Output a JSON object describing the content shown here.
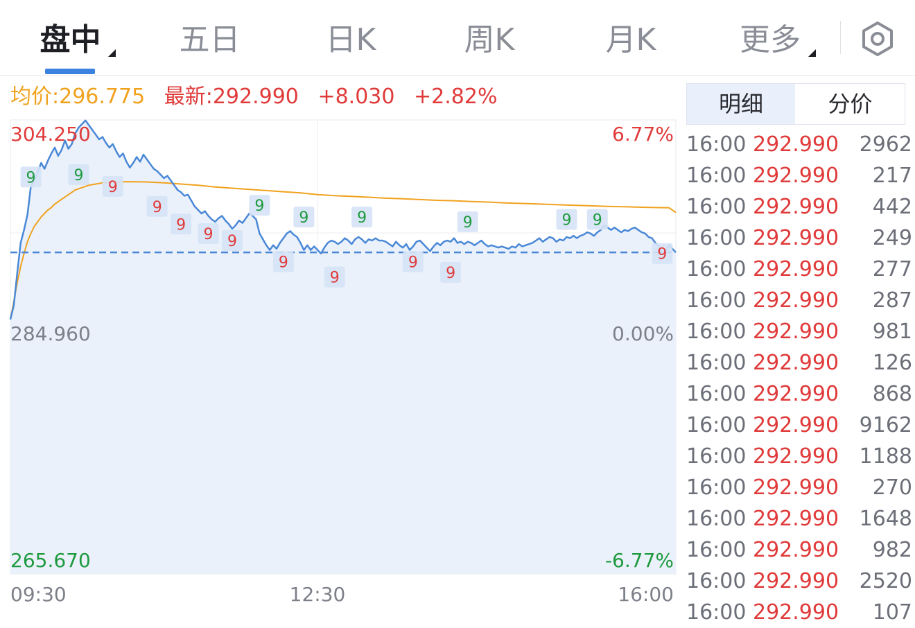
{
  "tabs": {
    "intraday": "盘中",
    "five_day": "五日",
    "day_k": "日K",
    "week_k": "周K",
    "month_k": "月K",
    "more": "更多"
  },
  "info": {
    "avg": "均价:296.775",
    "latest": "最新:292.990",
    "change": "+8.030",
    "change_pct": "+2.82%"
  },
  "side": {
    "tab_detail": "明细",
    "tab_price": "分价",
    "rows": [
      {
        "time": "16:00",
        "price": "292.990",
        "vol": "2962"
      },
      {
        "time": "16:00",
        "price": "292.990",
        "vol": "217"
      },
      {
        "time": "16:00",
        "price": "292.990",
        "vol": "442"
      },
      {
        "time": "16:00",
        "price": "292.990",
        "vol": "249"
      },
      {
        "time": "16:00",
        "price": "292.990",
        "vol": "277"
      },
      {
        "time": "16:00",
        "price": "292.990",
        "vol": "287"
      },
      {
        "time": "16:00",
        "price": "292.990",
        "vol": "981"
      },
      {
        "time": "16:00",
        "price": "292.990",
        "vol": "126"
      },
      {
        "time": "16:00",
        "price": "292.990",
        "vol": "868"
      },
      {
        "time": "16:00",
        "price": "292.990",
        "vol": "9162"
      },
      {
        "time": "16:00",
        "price": "292.990",
        "vol": "1188"
      },
      {
        "time": "16:00",
        "price": "292.990",
        "vol": "270"
      },
      {
        "time": "16:00",
        "price": "292.990",
        "vol": "1648"
      },
      {
        "time": "16:00",
        "price": "292.990",
        "vol": "982"
      },
      {
        "time": "16:00",
        "price": "292.990",
        "vol": "2520"
      },
      {
        "time": "16:00",
        "price": "292.990",
        "vol": "107"
      }
    ]
  },
  "chart_data": {
    "type": "line",
    "ylim": [
      265.67,
      304.25
    ],
    "pct_labels": [
      "6.77%",
      "0.00%",
      "-6.77%"
    ],
    "y_labels": [
      "304.250",
      "284.960",
      "265.670"
    ],
    "x_ticks": [
      "09:30",
      "12:30",
      "16:00"
    ],
    "x_range": [
      0,
      390
    ],
    "close_price": 292.99,
    "colors": {
      "price": "#4a88d6",
      "avg": "#f0a21e",
      "up": "#e03a3a",
      "down": "#1e9a3e",
      "fill": "#eaf1fb"
    },
    "series": [
      {
        "values": [
          [
            0,
            287.3
          ],
          [
            2,
            288.5
          ],
          [
            4,
            291.2
          ],
          [
            6,
            293.8
          ],
          [
            8,
            294.9
          ],
          [
            10,
            296.2
          ],
          [
            12,
            298.6
          ],
          [
            14,
            299.1
          ],
          [
            16,
            299.8
          ],
          [
            18,
            300.6
          ],
          [
            20,
            300.1
          ],
          [
            22,
            300.8
          ],
          [
            24,
            301.4
          ],
          [
            26,
            301.9
          ],
          [
            28,
            301.2
          ],
          [
            30,
            301.7
          ],
          [
            32,
            302.5
          ],
          [
            34,
            301.8
          ],
          [
            36,
            302.2
          ],
          [
            38,
            303.1
          ],
          [
            40,
            303.6
          ],
          [
            42,
            303.9
          ],
          [
            44,
            304.2
          ],
          [
            46,
            303.8
          ],
          [
            48,
            303.4
          ],
          [
            50,
            303.0
          ],
          [
            52,
            302.6
          ],
          [
            54,
            302.8
          ],
          [
            56,
            302.3
          ],
          [
            58,
            301.9
          ],
          [
            60,
            302.2
          ],
          [
            62,
            301.6
          ],
          [
            64,
            301.1
          ],
          [
            66,
            301.4
          ],
          [
            68,
            300.7
          ],
          [
            70,
            300.2
          ],
          [
            72,
            300.6
          ],
          [
            74,
            301.1
          ],
          [
            76,
            300.7
          ],
          [
            78,
            301.3
          ],
          [
            80,
            300.9
          ],
          [
            82,
            300.5
          ],
          [
            84,
            300.1
          ],
          [
            86,
            299.9
          ],
          [
            88,
            299.6
          ],
          [
            90,
            299.3
          ],
          [
            92,
            299.5
          ],
          [
            94,
            299.1
          ],
          [
            96,
            298.7
          ],
          [
            98,
            298.3
          ],
          [
            100,
            298.1
          ],
          [
            102,
            297.8
          ],
          [
            104,
            297.9
          ],
          [
            106,
            297.4
          ],
          [
            108,
            296.9
          ],
          [
            110,
            296.6
          ],
          [
            112,
            296.3
          ],
          [
            114,
            296.5
          ],
          [
            116,
            296.1
          ],
          [
            118,
            295.8
          ],
          [
            120,
            295.6
          ],
          [
            122,
            295.9
          ],
          [
            124,
            296.1
          ],
          [
            126,
            295.7
          ],
          [
            128,
            295.4
          ],
          [
            130,
            295.0
          ],
          [
            132,
            295.3
          ],
          [
            134,
            295.7
          ],
          [
            136,
            295.5
          ],
          [
            138,
            295.9
          ],
          [
            140,
            296.3
          ],
          [
            142,
            296.1
          ],
          [
            144,
            295.8
          ],
          [
            146,
            294.6
          ],
          [
            148,
            294.1
          ],
          [
            150,
            293.6
          ],
          [
            152,
            293.2
          ],
          [
            154,
            293.6
          ],
          [
            156,
            293.3
          ],
          [
            158,
            293.8
          ],
          [
            160,
            294.2
          ],
          [
            162,
            294.6
          ],
          [
            164,
            294.8
          ],
          [
            166,
            294.5
          ],
          [
            168,
            294.3
          ],
          [
            170,
            293.8
          ],
          [
            172,
            293.2
          ],
          [
            174,
            293.6
          ],
          [
            176,
            293.2
          ],
          [
            178,
            293.5
          ],
          [
            180,
            293.2
          ],
          [
            182,
            292.9
          ],
          [
            184,
            293.4
          ],
          [
            186,
            293.8
          ],
          [
            188,
            294.0
          ],
          [
            190,
            293.9
          ],
          [
            192,
            293.7
          ],
          [
            194,
            293.9
          ],
          [
            196,
            294.2
          ],
          [
            198,
            294.0
          ],
          [
            200,
            293.7
          ],
          [
            202,
            294.1
          ],
          [
            204,
            294.3
          ],
          [
            206,
            294.1
          ],
          [
            208,
            293.8
          ],
          [
            210,
            294.1
          ],
          [
            212,
            294.0
          ],
          [
            214,
            294.2
          ],
          [
            216,
            294.0
          ],
          [
            218,
            294.0
          ],
          [
            220,
            293.9
          ],
          [
            222,
            293.7
          ],
          [
            224,
            293.5
          ],
          [
            226,
            293.9
          ],
          [
            228,
            293.6
          ],
          [
            230,
            293.4
          ],
          [
            232,
            293.7
          ],
          [
            234,
            293.2
          ],
          [
            236,
            293.5
          ],
          [
            238,
            293.9
          ],
          [
            240,
            294.0
          ],
          [
            242,
            293.7
          ],
          [
            244,
            293.4
          ],
          [
            246,
            293.1
          ],
          [
            248,
            293.5
          ],
          [
            250,
            293.8
          ],
          [
            252,
            293.6
          ],
          [
            254,
            293.9
          ],
          [
            256,
            294.0
          ],
          [
            258,
            293.9
          ],
          [
            260,
            294.2
          ],
          [
            262,
            293.8
          ],
          [
            264,
            293.9
          ],
          [
            266,
            293.7
          ],
          [
            268,
            293.9
          ],
          [
            270,
            293.8
          ],
          [
            272,
            293.6
          ],
          [
            274,
            293.8
          ],
          [
            276,
            294.0
          ],
          [
            278,
            293.7
          ],
          [
            280,
            293.5
          ],
          [
            282,
            293.6
          ],
          [
            284,
            293.5
          ],
          [
            286,
            293.4
          ],
          [
            288,
            293.5
          ],
          [
            290,
            293.4
          ],
          [
            292,
            293.3
          ],
          [
            294,
            293.5
          ],
          [
            296,
            293.4
          ],
          [
            298,
            293.7
          ],
          [
            300,
            293.5
          ],
          [
            302,
            293.6
          ],
          [
            304,
            293.7
          ],
          [
            306,
            293.8
          ],
          [
            308,
            294.0
          ],
          [
            310,
            294.2
          ],
          [
            312,
            293.9
          ],
          [
            314,
            294.1
          ],
          [
            316,
            294.3
          ],
          [
            318,
            294.2
          ],
          [
            320,
            293.9
          ],
          [
            322,
            294.1
          ],
          [
            324,
            294.0
          ],
          [
            326,
            294.3
          ],
          [
            328,
            294.2
          ],
          [
            330,
            294.4
          ],
          [
            332,
            294.2
          ],
          [
            334,
            294.4
          ],
          [
            336,
            294.5
          ],
          [
            338,
            294.7
          ],
          [
            340,
            294.6
          ],
          [
            342,
            294.4
          ],
          [
            344,
            294.7
          ],
          [
            346,
            294.9
          ],
          [
            348,
            295.3
          ],
          [
            350,
            295.1
          ],
          [
            352,
            294.9
          ],
          [
            354,
            295.1
          ],
          [
            356,
            294.9
          ],
          [
            358,
            294.7
          ],
          [
            360,
            294.9
          ],
          [
            362,
            294.8
          ],
          [
            364,
            295.0
          ],
          [
            366,
            295.1
          ],
          [
            368,
            294.9
          ],
          [
            370,
            294.7
          ],
          [
            372,
            294.6
          ],
          [
            374,
            294.3
          ],
          [
            376,
            294.2
          ],
          [
            378,
            293.8
          ],
          [
            380,
            293.5
          ],
          [
            382,
            292.9
          ],
          [
            384,
            293.1
          ],
          [
            386,
            293.6
          ],
          [
            388,
            293.3
          ],
          [
            390,
            292.99
          ]
        ]
      },
      {
        "values": [
          [
            0,
            287.3
          ],
          [
            2,
            288.8
          ],
          [
            4,
            290.4
          ],
          [
            6,
            291.8
          ],
          [
            8,
            292.9
          ],
          [
            10,
            293.9
          ],
          [
            12,
            294.6
          ],
          [
            14,
            295.2
          ],
          [
            16,
            295.6
          ],
          [
            18,
            296.0
          ],
          [
            20,
            296.3
          ],
          [
            22,
            296.6
          ],
          [
            24,
            296.8
          ],
          [
            26,
            297.1
          ],
          [
            28,
            297.3
          ],
          [
            30,
            297.5
          ],
          [
            32,
            297.7
          ],
          [
            34,
            297.9
          ],
          [
            36,
            298.1
          ],
          [
            38,
            298.3
          ],
          [
            40,
            298.4
          ],
          [
            42,
            298.5
          ],
          [
            44,
            298.6
          ],
          [
            46,
            298.7
          ],
          [
            48,
            298.75
          ],
          [
            50,
            298.8
          ],
          [
            52,
            298.85
          ],
          [
            54,
            298.9
          ],
          [
            56,
            298.92
          ],
          [
            58,
            298.95
          ],
          [
            60,
            298.97
          ],
          [
            64,
            298.99
          ],
          [
            70,
            299.0
          ],
          [
            80,
            298.98
          ],
          [
            90,
            298.9
          ],
          [
            100,
            298.8
          ],
          [
            110,
            298.7
          ],
          [
            120,
            298.55
          ],
          [
            130,
            298.45
          ],
          [
            140,
            298.35
          ],
          [
            150,
            298.25
          ],
          [
            160,
            298.15
          ],
          [
            170,
            298.05
          ],
          [
            180,
            297.9
          ],
          [
            190,
            297.82
          ],
          [
            200,
            297.75
          ],
          [
            210,
            297.68
          ],
          [
            220,
            297.6
          ],
          [
            230,
            297.55
          ],
          [
            240,
            297.48
          ],
          [
            250,
            297.42
          ],
          [
            260,
            297.38
          ],
          [
            270,
            297.32
          ],
          [
            280,
            297.27
          ],
          [
            290,
            297.2
          ],
          [
            300,
            297.15
          ],
          [
            310,
            297.1
          ],
          [
            320,
            297.05
          ],
          [
            330,
            297.0
          ],
          [
            340,
            296.95
          ],
          [
            350,
            296.9
          ],
          [
            360,
            296.87
          ],
          [
            370,
            296.83
          ],
          [
            380,
            296.8
          ],
          [
            386,
            296.78
          ],
          [
            390,
            296.38
          ]
        ]
      }
    ],
    "markers": [
      {
        "x": 12,
        "v": 299.4,
        "type": "down"
      },
      {
        "x": 40,
        "v": 299.6,
        "type": "down"
      },
      {
        "x": 60,
        "v": 298.6,
        "type": "up"
      },
      {
        "x": 86,
        "v": 296.9,
        "type": "up"
      },
      {
        "x": 100,
        "v": 295.4,
        "type": "up"
      },
      {
        "x": 116,
        "v": 294.6,
        "type": "up"
      },
      {
        "x": 130,
        "v": 294.0,
        "type": "up"
      },
      {
        "x": 146,
        "v": 297.0,
        "type": "down"
      },
      {
        "x": 160,
        "v": 292.2,
        "type": "up"
      },
      {
        "x": 172,
        "v": 296.0,
        "type": "down"
      },
      {
        "x": 190,
        "v": 290.9,
        "type": "up"
      },
      {
        "x": 206,
        "v": 296.0,
        "type": "down"
      },
      {
        "x": 236,
        "v": 292.2,
        "type": "up"
      },
      {
        "x": 258,
        "v": 291.3,
        "type": "up"
      },
      {
        "x": 268,
        "v": 295.6,
        "type": "down"
      },
      {
        "x": 326,
        "v": 295.8,
        "type": "down"
      },
      {
        "x": 344,
        "v": 295.8,
        "type": "down"
      },
      {
        "x": 382,
        "v": 292.9,
        "type": "up"
      }
    ]
  }
}
